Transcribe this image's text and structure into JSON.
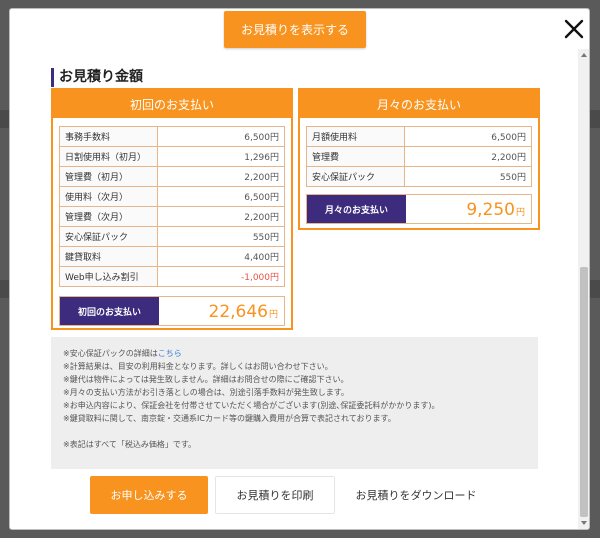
{
  "header": {
    "show_estimate_label": "お見積りを表示する",
    "section_title": "お見積り金額"
  },
  "initial": {
    "header": "初回のお支払い",
    "items": [
      {
        "label": "事務手数料",
        "value": "6,500円"
      },
      {
        "label": "日割使用料（初月）",
        "value": "1,296円"
      },
      {
        "label": "管理費（初月）",
        "value": "2,200円"
      },
      {
        "label": "使用料（次月）",
        "value": "6,500円"
      },
      {
        "label": "管理費（次月）",
        "value": "2,200円"
      },
      {
        "label": "安心保証パック",
        "value": "550円"
      },
      {
        "label": "鍵貸取料",
        "value": "4,400円"
      },
      {
        "label": "Web申し込み割引",
        "value": "-1,000円"
      }
    ],
    "total_label": "初回のお支払い",
    "total_value": "22,646",
    "total_unit": "円"
  },
  "monthly": {
    "header": "月々のお支払い",
    "items": [
      {
        "label": "月額使用料",
        "value": "6,500円"
      },
      {
        "label": "管理費",
        "value": "2,200円"
      },
      {
        "label": "安心保証パック",
        "value": "550円"
      }
    ],
    "total_label": "月々のお支払い",
    "total_value": "9,250",
    "total_unit": "円"
  },
  "notes": {
    "line1_prefix": "※安心保証パックの詳細は",
    "line1_link": "こちら",
    "lines": [
      "※計算結果は、目安の利用料金となります。詳しくはお問い合わせ下さい。",
      "※鍵代は物件によっては発生致しません。詳細はお問合せの際にご確認下さい。",
      "※月々の支払い方法がお引き落としの場合は、別途引落手数料が発生致します。",
      "※お申込内容により、保証会社を付帯させていただく場合がございます(別途､保証委託料がかかります)。",
      "※鍵貸取料に関して、南京錠・交通系ICカード等の鍵購入費用が合算で表記されております。"
    ],
    "tax_note": "※表記はすべて「税込み価格」です。"
  },
  "footer": {
    "apply_label": "お申し込みする",
    "print_label": "お見積りを印刷",
    "download_label": "お見積りをダウンロード"
  },
  "colors": {
    "accent": "#f7931e",
    "total_label_bg": "#3d2c7e",
    "negative": "#e8524a"
  }
}
